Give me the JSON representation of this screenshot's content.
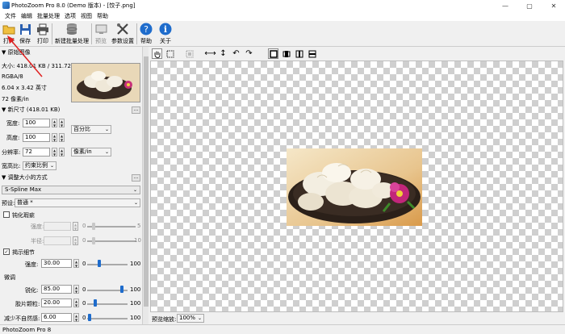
{
  "window": {
    "title": "PhotoZoom Pro 8.0 (Demo 版本) - [饺子.png]",
    "minimize": "—",
    "maximize": "▢",
    "close": "✕"
  },
  "menu": [
    "文件",
    "编辑",
    "批量处理",
    "选项",
    "视图",
    "帮助"
  ],
  "toolbar": {
    "open": "打开",
    "save": "保存",
    "print": "打印",
    "batch": "新建批量处理",
    "preview": "预览",
    "settings": "参数设置",
    "help": "帮助",
    "about": "关于"
  },
  "original": {
    "header": "原始图像",
    "size": "大小: 418.01 KB / 311.72 KB",
    "mode": "RGBA/8",
    "dims": "6.04 x 3.42 英寸",
    "res": "72 像素/in"
  },
  "newsize": {
    "header": "新尺寸 (418.01 KB)",
    "width_label": "宽度:",
    "width_value": "100",
    "height_label": "高度:",
    "height_value": "100",
    "unit": "百分比",
    "res_label": "分辨率:",
    "res_value": "72",
    "res_unit": "像素/in",
    "aspect_label": "宽高比:",
    "aspect_value": "约束比例"
  },
  "resize": {
    "header": "调整大小的方式",
    "method": "S-Spline Max",
    "preset_label": "预设:",
    "preset_value": "普通 *",
    "noise_label": "钝化瑕疵",
    "strength_label": "强度:",
    "strength_min": "0",
    "strength_max": "5",
    "radius_label": "半径:",
    "radius_min": "0",
    "radius_max": "10",
    "detail_label": "揭示细节",
    "detail_strength_label": "强度:",
    "detail_strength_value": "30.00",
    "detail_min": "0",
    "detail_max": "100",
    "fine_label": "微调",
    "sharpen_label": "锐化:",
    "sharpen_value": "85.00",
    "sharpen_min": "0",
    "sharpen_max": "100",
    "film_label": "胶片颗粒:",
    "film_value": "20.00",
    "film_min": "0",
    "film_max": "100",
    "artifact_label": "减少不自然感:",
    "artifact_value": "6.00",
    "artifact_min": "0",
    "artifact_max": "100"
  },
  "levels": {
    "detail_strength": 0.3,
    "sharpen": 0.85,
    "film_grain": 0.2,
    "artifact": 0.06,
    "strength": 0.0,
    "radius": 0.0
  },
  "preview_zoom": {
    "label": "预览缩放:",
    "value": "100%"
  },
  "status": "PhotoZoom Pro 8",
  "colors": {
    "accent": "#1e6ccc",
    "arrow": "#e02020"
  }
}
